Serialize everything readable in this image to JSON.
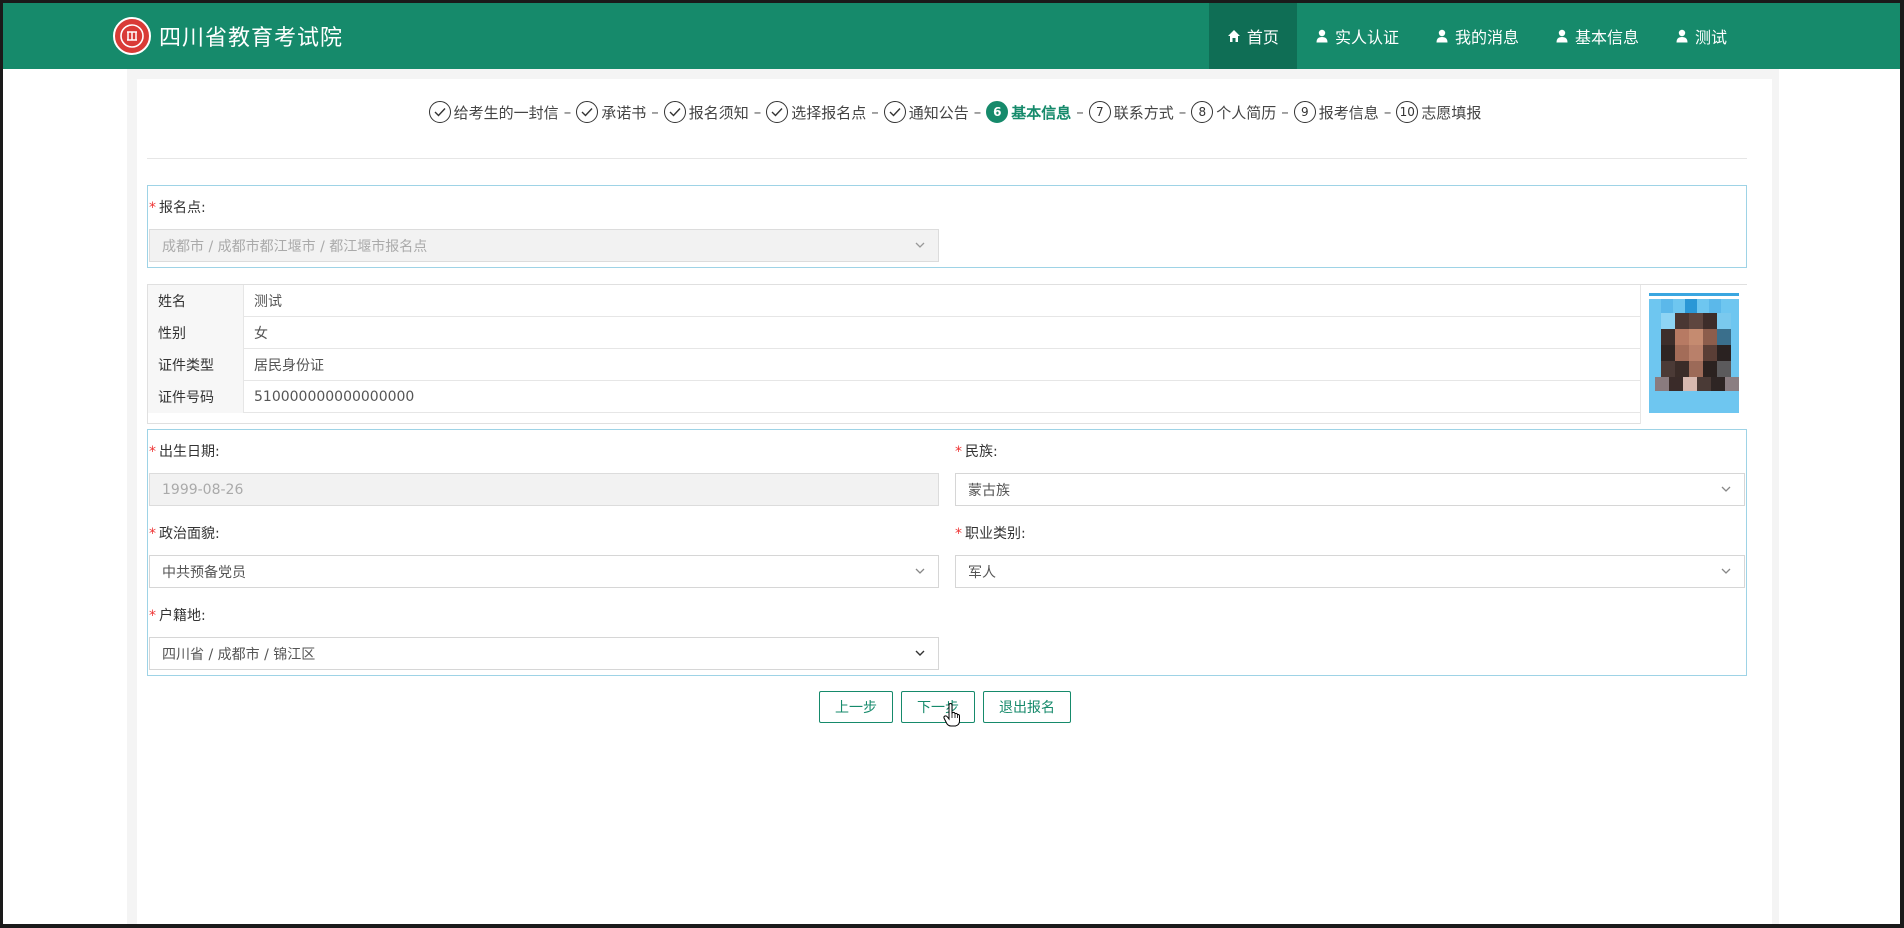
{
  "header": {
    "site_title": "四川省教育考试院",
    "nav": [
      {
        "label": "首页",
        "icon": "home-icon",
        "active": true
      },
      {
        "label": "实人认证",
        "icon": "user-icon"
      },
      {
        "label": "我的消息",
        "icon": "user-icon"
      },
      {
        "label": "基本信息",
        "icon": "user-icon"
      },
      {
        "label": "测试",
        "icon": "user-icon"
      }
    ]
  },
  "steps": [
    {
      "label": "给考生的一封信",
      "state": "done"
    },
    {
      "label": "承诺书",
      "state": "done"
    },
    {
      "label": "报名须知",
      "state": "done"
    },
    {
      "label": "选择报名点",
      "state": "done"
    },
    {
      "label": "通知公告",
      "state": "done"
    },
    {
      "number": "6",
      "label": "基本信息",
      "state": "current"
    },
    {
      "number": "7",
      "label": "联系方式",
      "state": "todo"
    },
    {
      "number": "8",
      "label": "个人简历",
      "state": "todo"
    },
    {
      "number": "9",
      "label": "报考信息",
      "state": "todo"
    },
    {
      "number": "10",
      "label": "志愿填报",
      "state": "todo"
    }
  ],
  "registration": {
    "label": "报名点:",
    "value": "成都市 / 成都市都江堰市 / 都江堰市报名点"
  },
  "info": {
    "rows": [
      {
        "key": "姓名",
        "value": "测试"
      },
      {
        "key": "性别",
        "value": "女"
      },
      {
        "key": "证件类型",
        "value": "居民身份证"
      },
      {
        "key": "证件号码",
        "value": "510000000000000000"
      }
    ]
  },
  "form": {
    "birth_label": "出生日期:",
    "birth_value": "1999-08-26",
    "ethnicity_label": "民族:",
    "ethnicity_value": "蒙古族",
    "political_label": "政治面貌:",
    "political_value": "中共预备党员",
    "occupation_label": "职业类别:",
    "occupation_value": "军人",
    "hukou_label": "户籍地:",
    "hukou_value": "四川省 / 成都市 / 锦江区"
  },
  "buttons": {
    "prev": "上一步",
    "next": "下一步",
    "exit": "退出报名"
  },
  "colors": {
    "brand": "#168a6b",
    "accent_dark": "#0f6e55",
    "section_border": "#9ed3e6",
    "required": "#e33333"
  }
}
